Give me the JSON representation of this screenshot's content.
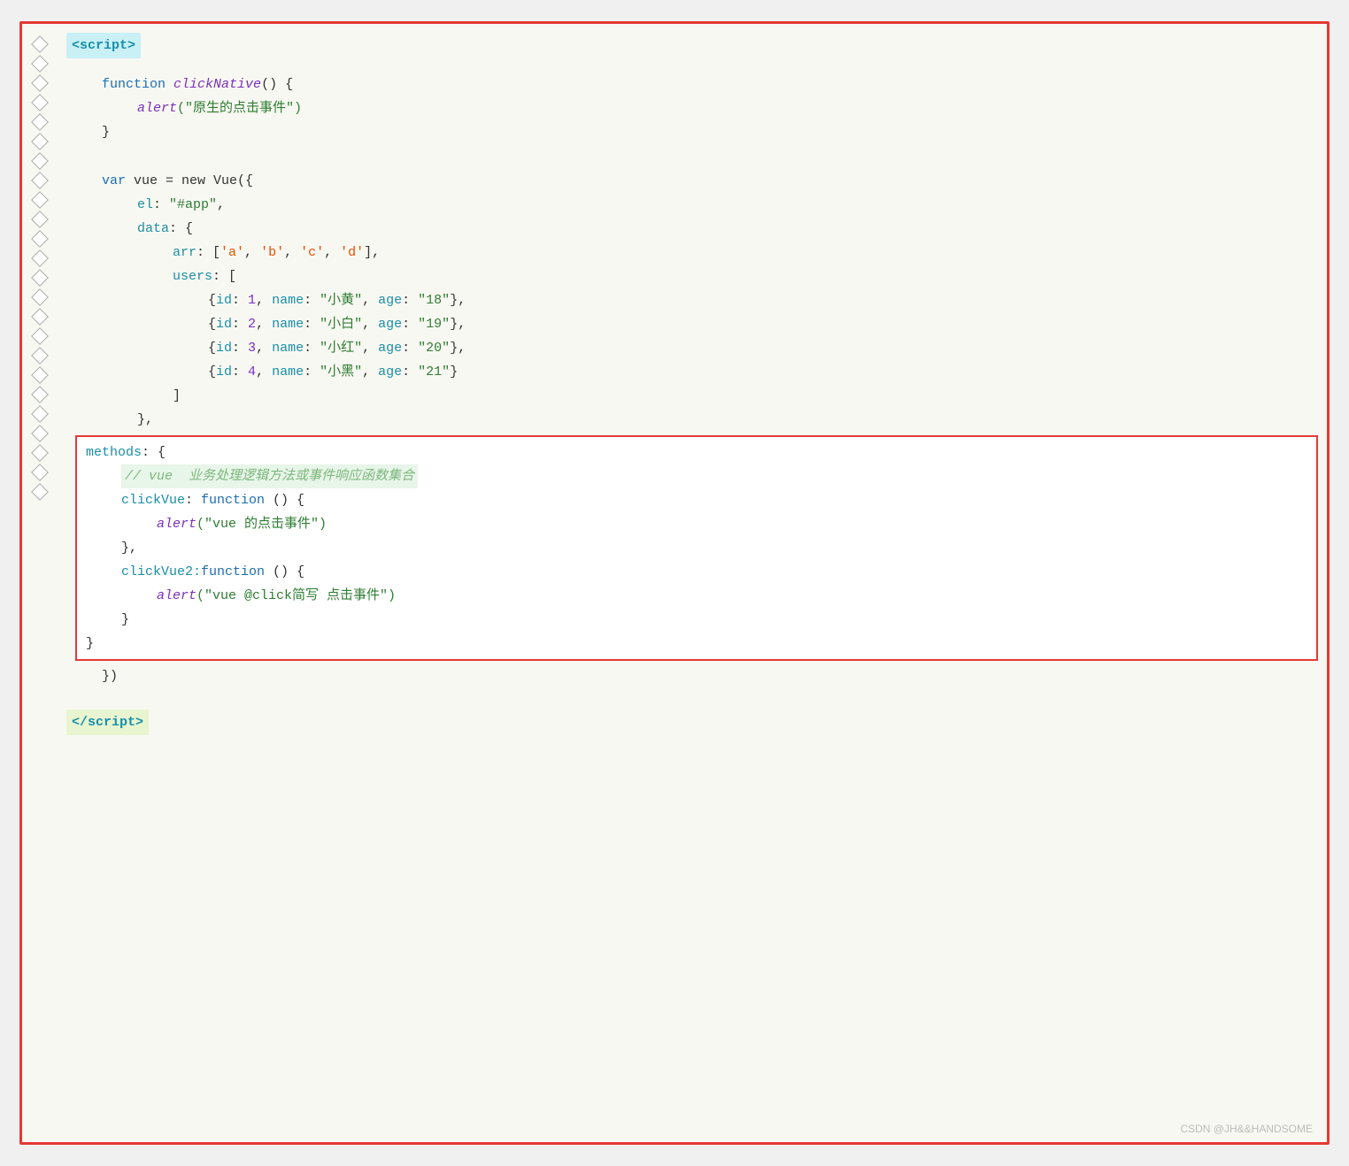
{
  "editor": {
    "border_color": "#e53935",
    "background": "#f8f8f2",
    "watermark": "CSDN @JH&&HANDSOME"
  },
  "code": {
    "script_open": "<script>",
    "script_close": "</script>",
    "line1_kw": "function",
    "line1_fn": "clickNative",
    "line1_rest": "() {",
    "line2_fn": "alert",
    "line2_str": "(\"原生的点击事件\")",
    "line3": "}",
    "line5_kw": "var",
    "line5_rest": " vue = new Vue({",
    "line6": "    el: \"#app\",",
    "line7": "    data: {",
    "line8_key": "        arr:",
    "line8_val": " ['a', 'b', 'c', 'd'],",
    "line9_key": "        users:",
    "line9_val": " [",
    "line10": "            {id: 1, name: \"小黄\", age: \"18\"},",
    "line11": "            {id: 2, name: \"小白\", age: \"19\"},",
    "line12": "            {id: 3, name: \"小红\", age: \"20\"},",
    "line13": "            {id: 4, name: \"小黑\", age: \"21\"}",
    "line14": "        ]",
    "line15": "    },",
    "methods_key": "    methods: {",
    "comment": "        // vue  业务处理逻辑方法或事件响应函数集合",
    "clickvue_key": "        clickVue:",
    "clickvue_kw": " function",
    "clickvue_rest": " () {",
    "alert1_fn": "            alert",
    "alert1_str": "(\"vue 的点击事件\")",
    "closing1": "        },",
    "clickvue2_key": "        clickVue2:",
    "clickvue2_kw": "function",
    "clickvue2_rest": " () {",
    "alert2_fn": "            alert",
    "alert2_str": "(\"vue @click简写 点击事件\")",
    "closing2": "        }",
    "closing3": "    }",
    "closing4": "})",
    "watermark_text": "CSDN @JH&&HANDSOME"
  }
}
